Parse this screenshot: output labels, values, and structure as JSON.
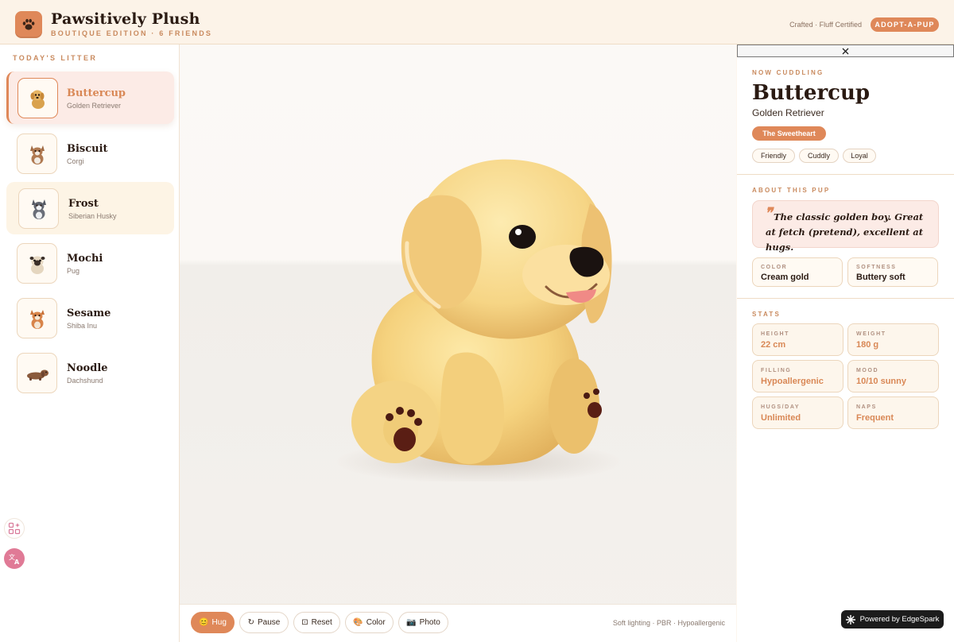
{
  "header": {
    "brand_title": "Pawsitively Plush",
    "brand_subtitle": "BOUTIQUE EDITION · 6 FRIENDS",
    "certification": "Crafted · Fluff Certified",
    "adopt_label": "ADOPT-A-PUP",
    "logo_icon": "paw-icon"
  },
  "sidebar": {
    "title": "TODAY'S LITTER",
    "items": [
      {
        "name": "Buttercup",
        "breed": "Golden Retriever",
        "icon": "golden-retriever-plush-icon"
      },
      {
        "name": "Biscuit",
        "breed": "Corgi",
        "icon": "corgi-plush-icon"
      },
      {
        "name": "Frost",
        "breed": "Siberian Husky",
        "icon": "husky-plush-icon"
      },
      {
        "name": "Mochi",
        "breed": "Pug",
        "icon": "pug-plush-icon"
      },
      {
        "name": "Sesame",
        "breed": "Shiba Inu",
        "icon": "shiba-plush-icon"
      },
      {
        "name": "Noodle",
        "breed": "Dachshund",
        "icon": "dachshund-plush-icon"
      }
    ],
    "active_index": 0,
    "tools": [
      "sparkle-grid-icon",
      "translate-icon"
    ]
  },
  "stage": {
    "controls": [
      {
        "label": "Hug",
        "glyph": "😊"
      },
      {
        "label": "Pause",
        "glyph": "↻"
      },
      {
        "label": "Reset",
        "glyph": "⊡"
      },
      {
        "label": "Color",
        "glyph": "🎨"
      },
      {
        "label": "Photo",
        "glyph": "📷"
      }
    ],
    "info": "Soft lighting · PBR · Hypoallergenic"
  },
  "detail": {
    "eyebrow": "NOW CUDDLING",
    "name": "Buttercup",
    "breed": "Golden Retriever",
    "persona": "The Sweetheart",
    "tags": [
      "Friendly",
      "Cuddly",
      "Loyal"
    ],
    "about_title": "ABOUT THIS PUP",
    "quote": "The classic golden boy. Great at fetch (pretend), excellent at hugs.",
    "attributes": [
      {
        "label": "COLOR",
        "value": "Cream gold"
      },
      {
        "label": "SOFTNESS",
        "value": "Buttery soft"
      }
    ],
    "stats_title": "STATS",
    "stats": [
      {
        "label": "HEIGHT",
        "value": "22 cm"
      },
      {
        "label": "WEIGHT",
        "value": "180 g"
      },
      {
        "label": "FILLING",
        "value": "Hypoallergenic"
      },
      {
        "label": "MOOD",
        "value": "10/10 sunny"
      },
      {
        "label": "HUGS/DAY",
        "value": "Unlimited"
      },
      {
        "label": "NAPS",
        "value": "Frequent"
      }
    ]
  },
  "footer": {
    "powered": "Powered by EdgeSpark"
  },
  "colors": {
    "accent": "#df8859",
    "ink": "#2a1a12",
    "cream": "#fdf6ee",
    "plush": "#f5d27e"
  }
}
